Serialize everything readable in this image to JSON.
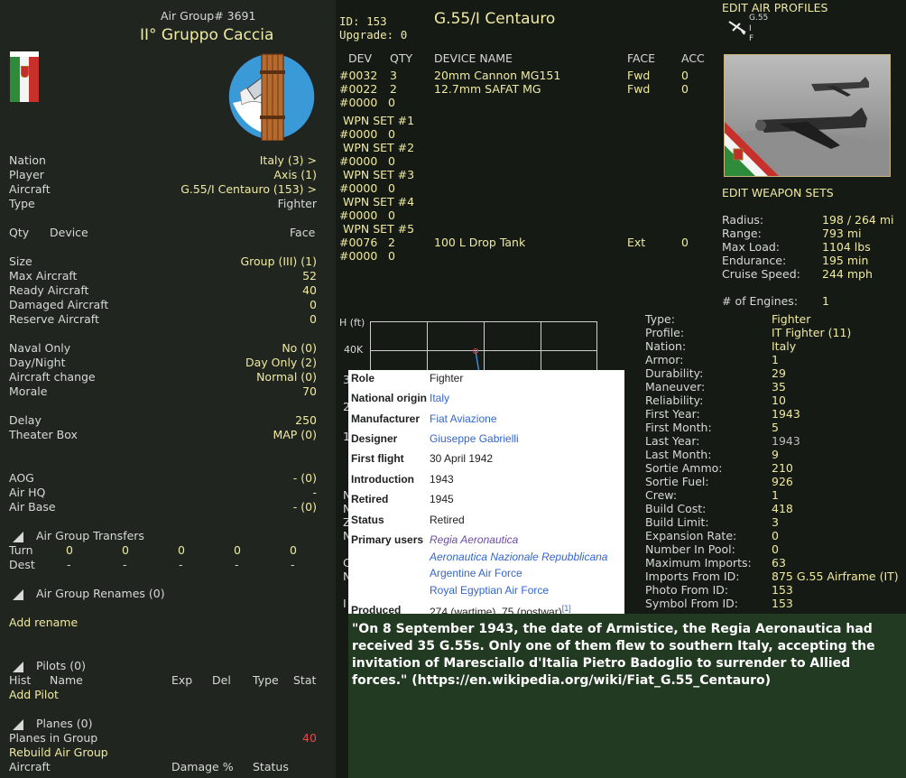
{
  "colors": {
    "accent": "#f0eaa0",
    "text": "#d8d8d8",
    "alert": "#e24a4a",
    "link": "#3366cc"
  },
  "header": {
    "air_group_no": "Air Group# 3691",
    "name": "II° Gruppo Caccia"
  },
  "info": [
    {
      "label": "Nation",
      "value": "Italy (3) >"
    },
    {
      "label": "Player",
      "value": "Axis (1)"
    },
    {
      "label": "Aircraft",
      "value": "G.55/I Centauro (153) >"
    },
    {
      "label": "Type",
      "value": "Fighter"
    }
  ],
  "qty_header": {
    "qty": "Qty",
    "device": "Device",
    "face": "Face"
  },
  "size": [
    {
      "label": "Size",
      "value": "Group (III) (1)"
    },
    {
      "label": "Max Aircraft",
      "value": "52"
    },
    {
      "label": "Ready Aircraft",
      "value": "40"
    },
    {
      "label": "Damaged Aircraft",
      "value": "0"
    },
    {
      "label": "Reserve Aircraft",
      "value": "0"
    }
  ],
  "options": [
    {
      "label": "Naval Only",
      "value": "No (0)"
    },
    {
      "label": "Day/Night",
      "value": "Day Only (2)"
    },
    {
      "label": "Aircraft change",
      "value": "Normal (0)"
    },
    {
      "label": "Morale",
      "value": "70"
    }
  ],
  "delay": [
    {
      "label": "Delay",
      "value": "250"
    },
    {
      "label": "Theater Box",
      "value": "MAP (0)"
    }
  ],
  "bases": [
    {
      "label": "AOG",
      "value": "- (0)"
    },
    {
      "label": "Air HQ",
      "value": "-"
    },
    {
      "label": "Air Base",
      "value": "- (0)"
    }
  ],
  "transfers": {
    "title": "Air Group Transfers",
    "turn_label": "Turn",
    "turn_values": [
      "0",
      "0",
      "0",
      "0",
      "0"
    ],
    "dest_label": "Dest",
    "dest_values": [
      "-",
      "-",
      "-",
      "-",
      "-"
    ]
  },
  "renames": {
    "title": "Air Group Renames (0)",
    "add": "Add rename"
  },
  "pilots": {
    "title": "Pilots (0)",
    "cols": [
      "Hist",
      "Name",
      "Exp",
      "Del",
      "Type",
      "Stat"
    ],
    "add": "Add Pilot"
  },
  "planes": {
    "title": "Planes (0)",
    "in_group_label": "Planes in Group",
    "in_group_value": "40",
    "rebuild": "Rebuild Air Group",
    "cols": [
      "Aircraft",
      "Damage %",
      "Status"
    ]
  },
  "aircraft": {
    "id": "ID: 153",
    "upgrade": "Upgrade: 0",
    "name": "G.55/I Centauro"
  },
  "devices": {
    "headers": [
      "DEV",
      "QTY",
      "DEVICE NAME",
      "FACE",
      "ACC"
    ],
    "rows": [
      {
        "dev": "#0032",
        "qty": "3",
        "name": "20mm Cannon MG151",
        "face": "Fwd",
        "acc": "0"
      },
      {
        "dev": "#0022",
        "qty": "2",
        "name": "12.7mm SAFAT MG",
        "face": "Fwd",
        "acc": "0"
      },
      {
        "dev": "#0000",
        "qty": "0",
        "name": "",
        "face": "",
        "acc": ""
      }
    ]
  },
  "weapon_sets": [
    {
      "title": "WPN SET #1",
      "dev": "#0000",
      "qty": "0",
      "name": "",
      "face": "",
      "acc": ""
    },
    {
      "title": "WPN SET #2",
      "dev": "#0000",
      "qty": "0",
      "name": "",
      "face": "",
      "acc": ""
    },
    {
      "title": "WPN SET #3",
      "dev": "#0000",
      "qty": "0",
      "name": "",
      "face": "",
      "acc": ""
    },
    {
      "title": "WPN SET #4",
      "dev": "#0000",
      "qty": "0",
      "name": "",
      "face": "",
      "acc": ""
    },
    {
      "title": "WPN SET #5",
      "dev": "#0076",
      "qty": "2",
      "name": "100 L Drop Tank",
      "face": "Ext",
      "acc": "0",
      "extra_dev": "#0000",
      "extra_qty": "0"
    }
  ],
  "profiles": {
    "edit_air_profiles": "EDIT AIR PROFILES",
    "mini_labels": [
      "G.55",
      "I",
      "F"
    ],
    "edit_weapon_sets": "EDIT WEAPON SETS"
  },
  "performance": [
    {
      "label": "Radius:",
      "value": "198 / 264 mi"
    },
    {
      "label": "Range:",
      "value": "793 mi"
    },
    {
      "label": "Max Load:",
      "value": "1104 lbs"
    },
    {
      "label": "Endurance:",
      "value": "195 min"
    },
    {
      "label": "Cruise Speed:",
      "value": "244 mph"
    }
  ],
  "engines": {
    "label": "# of Engines:",
    "value": "1"
  },
  "graph": {
    "ylabel": "H (ft)",
    "tick": "40K",
    "partial_ticks": [
      "3",
      "2",
      "1"
    ],
    "side_letters": [
      "N",
      "N",
      "Z",
      "N",
      "C",
      "N",
      "I"
    ]
  },
  "stats": [
    {
      "label": "Type:",
      "value": "Fighter"
    },
    {
      "label": "Profile:",
      "value": "IT Fighter (11)"
    },
    {
      "label": "Nation:",
      "value": "Italy"
    },
    {
      "label": "Armor:",
      "value": "1"
    },
    {
      "label": "Durability:",
      "value": "29"
    },
    {
      "label": "Maneuver:",
      "value": "35"
    },
    {
      "label": "Reliability:",
      "value": "10"
    },
    {
      "label": "First Year:",
      "value": "1943"
    },
    {
      "label": "First Month:",
      "value": "5"
    },
    {
      "label": "Last Year:",
      "value": "1943"
    },
    {
      "label": "Last Month:",
      "value": "9"
    },
    {
      "label": "Sortie Ammo:",
      "value": "210"
    },
    {
      "label": "Sortie Fuel:",
      "value": "926"
    },
    {
      "label": "Crew:",
      "value": "1"
    },
    {
      "label": "Build Cost:",
      "value": "418"
    },
    {
      "label": "Build Limit:",
      "value": "3"
    },
    {
      "label": "Expansion Rate:",
      "value": "0"
    },
    {
      "label": "Number In Pool:",
      "value": "0"
    },
    {
      "label": "Maximum Imports:",
      "value": "63"
    },
    {
      "label": "Imports From ID:",
      "value": "875  G.55 Airframe (IT)"
    },
    {
      "label": "Photo From ID:",
      "value": "153"
    },
    {
      "label": "Symbol From ID:",
      "value": "153"
    }
  ],
  "wiki": {
    "role_label": "Role",
    "role": "Fighter",
    "origin_label": "National origin",
    "origin": "Italy",
    "manufacturer_label": "Manufacturer",
    "manufacturer": "Fiat Aviazione",
    "designer_label": "Designer",
    "designer": "Giuseppe Gabrielli",
    "first_flight_label": "First flight",
    "first_flight": "30 April 1942",
    "introduction_label": "Introduction",
    "introduction": "1943",
    "retired_label": "Retired",
    "retired": "1945",
    "status_label": "Status",
    "status": "Retired",
    "users_label": "Primary users",
    "users": [
      "Regia Aeronautica",
      "Aeronautica Nazionale Repubblicana",
      "Argentine Air Force",
      "Royal Egyptian Air Force"
    ],
    "produced_label": "Produced",
    "produced": "274 (wartime), 75 (postwar)",
    "produced_ref": "[1]"
  },
  "quote": "\"On 8 September 1943, the date of Armistice, the Regia Aeronautica had received 35 G.55s. Only one of them flew to southern Italy, accepting the invitation of Maresciallo d'Italia Pietro Badoglio to surrender to Allied forces.\" (https://en.wikipedia.org/wiki/Fiat_G.55_Centauro)"
}
